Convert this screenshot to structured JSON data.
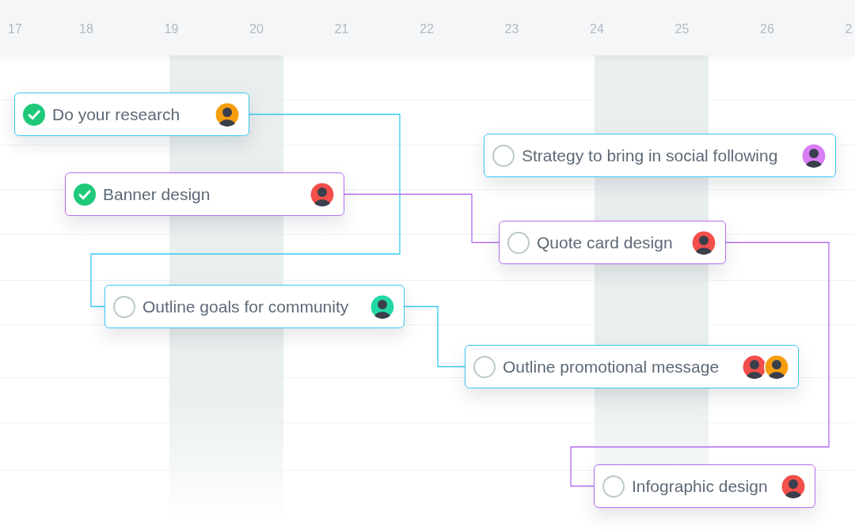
{
  "timeline": {
    "days": [
      {
        "label": "17",
        "weekend": false
      },
      {
        "label": "18",
        "weekend": false
      },
      {
        "label": "19",
        "weekend": true
      },
      {
        "label": "20",
        "weekend": true
      },
      {
        "label": "21",
        "weekend": false
      },
      {
        "label": "22",
        "weekend": false
      },
      {
        "label": "23",
        "weekend": false
      },
      {
        "label": "24",
        "weekend": true
      },
      {
        "label": "25",
        "weekend": true
      },
      {
        "label": "26",
        "weekend": false
      },
      {
        "label": "2",
        "weekend": false
      }
    ]
  },
  "tasks": [
    {
      "title": "Do your research",
      "done": true,
      "color": "#38c8f2",
      "assignees": [
        {
          "color": "#f59d0e"
        }
      ],
      "children": [
        {
          "title": "Outline goals for community",
          "done": false,
          "color": "#38c8f2",
          "assignees": [
            {
              "color": "#22d8a5"
            }
          ],
          "children": [
            {
              "title": "Outline promotional message",
              "done": false,
              "color": "#38c8f2",
              "assignees": [
                {
                  "color": "#f24f4a"
                },
                {
                  "color": "#f59d0e"
                }
              ]
            }
          ]
        }
      ]
    },
    {
      "title": "Strategy to bring in social following",
      "done": false,
      "color": "#38c8f2",
      "assignees": [
        {
          "color": "#d97ef4"
        }
      ]
    },
    {
      "title": "Banner design",
      "done": true,
      "color": "#b46cf0",
      "assignees": [
        {
          "color": "#f24f4a"
        }
      ],
      "children": [
        {
          "title": "Quote card design",
          "done": false,
          "color": "#b46cf0",
          "assignees": [
            {
              "color": "#f24f4a"
            }
          ],
          "children": [
            {
              "title": "Infographic design",
              "done": false,
              "color": "#b46cf0",
              "assignees": [
                {
                  "color": "#f24f4a"
                }
              ]
            }
          ]
        }
      ]
    }
  ]
}
